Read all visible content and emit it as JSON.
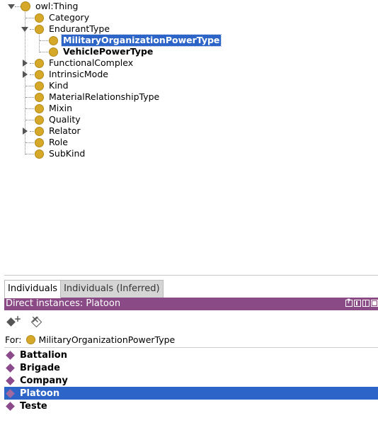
{
  "tree": {
    "root": {
      "label": "owl:Thing"
    },
    "category": {
      "label": "Category"
    },
    "endurant_type": {
      "label": "EndurantType",
      "children": [
        {
          "label": "MilitaryOrganizationPowerType",
          "selected": true
        },
        {
          "label": "VehiclePowerType"
        }
      ]
    },
    "functional_complex": {
      "label": "FunctionalComplex"
    },
    "intrinsic_mode": {
      "label": "IntrinsicMode"
    },
    "kind": {
      "label": "Kind"
    },
    "material_relationship_type": {
      "label": "MaterialRelationshipType"
    },
    "mixin": {
      "label": "Mixin"
    },
    "quality": {
      "label": "Quality"
    },
    "relator": {
      "label": "Relator"
    },
    "role": {
      "label": "Role"
    },
    "subkind": {
      "label": "SubKind"
    }
  },
  "tabs": [
    {
      "label": "Individuals",
      "active": true
    },
    {
      "label": "Individuals (Inferred)",
      "active": false
    }
  ],
  "view": {
    "title": "Direct instances: Platoon",
    "for_prefix": "For:",
    "for_class": "MilitaryOrganizationPowerType",
    "header_color": "#8a4a86"
  },
  "toolbar": {
    "add_icon": "add-individual-icon",
    "delete_icon": "delete-individual-icon"
  },
  "individuals": [
    {
      "label": "Battalion"
    },
    {
      "label": "Brigade"
    },
    {
      "label": "Company"
    },
    {
      "label": "Platoon",
      "selected": true
    },
    {
      "label": "Teste"
    }
  ],
  "colors": {
    "selection": "#2c64c7",
    "class_icon": "#d6a82a",
    "individual_icon": "#8b4a8b"
  }
}
